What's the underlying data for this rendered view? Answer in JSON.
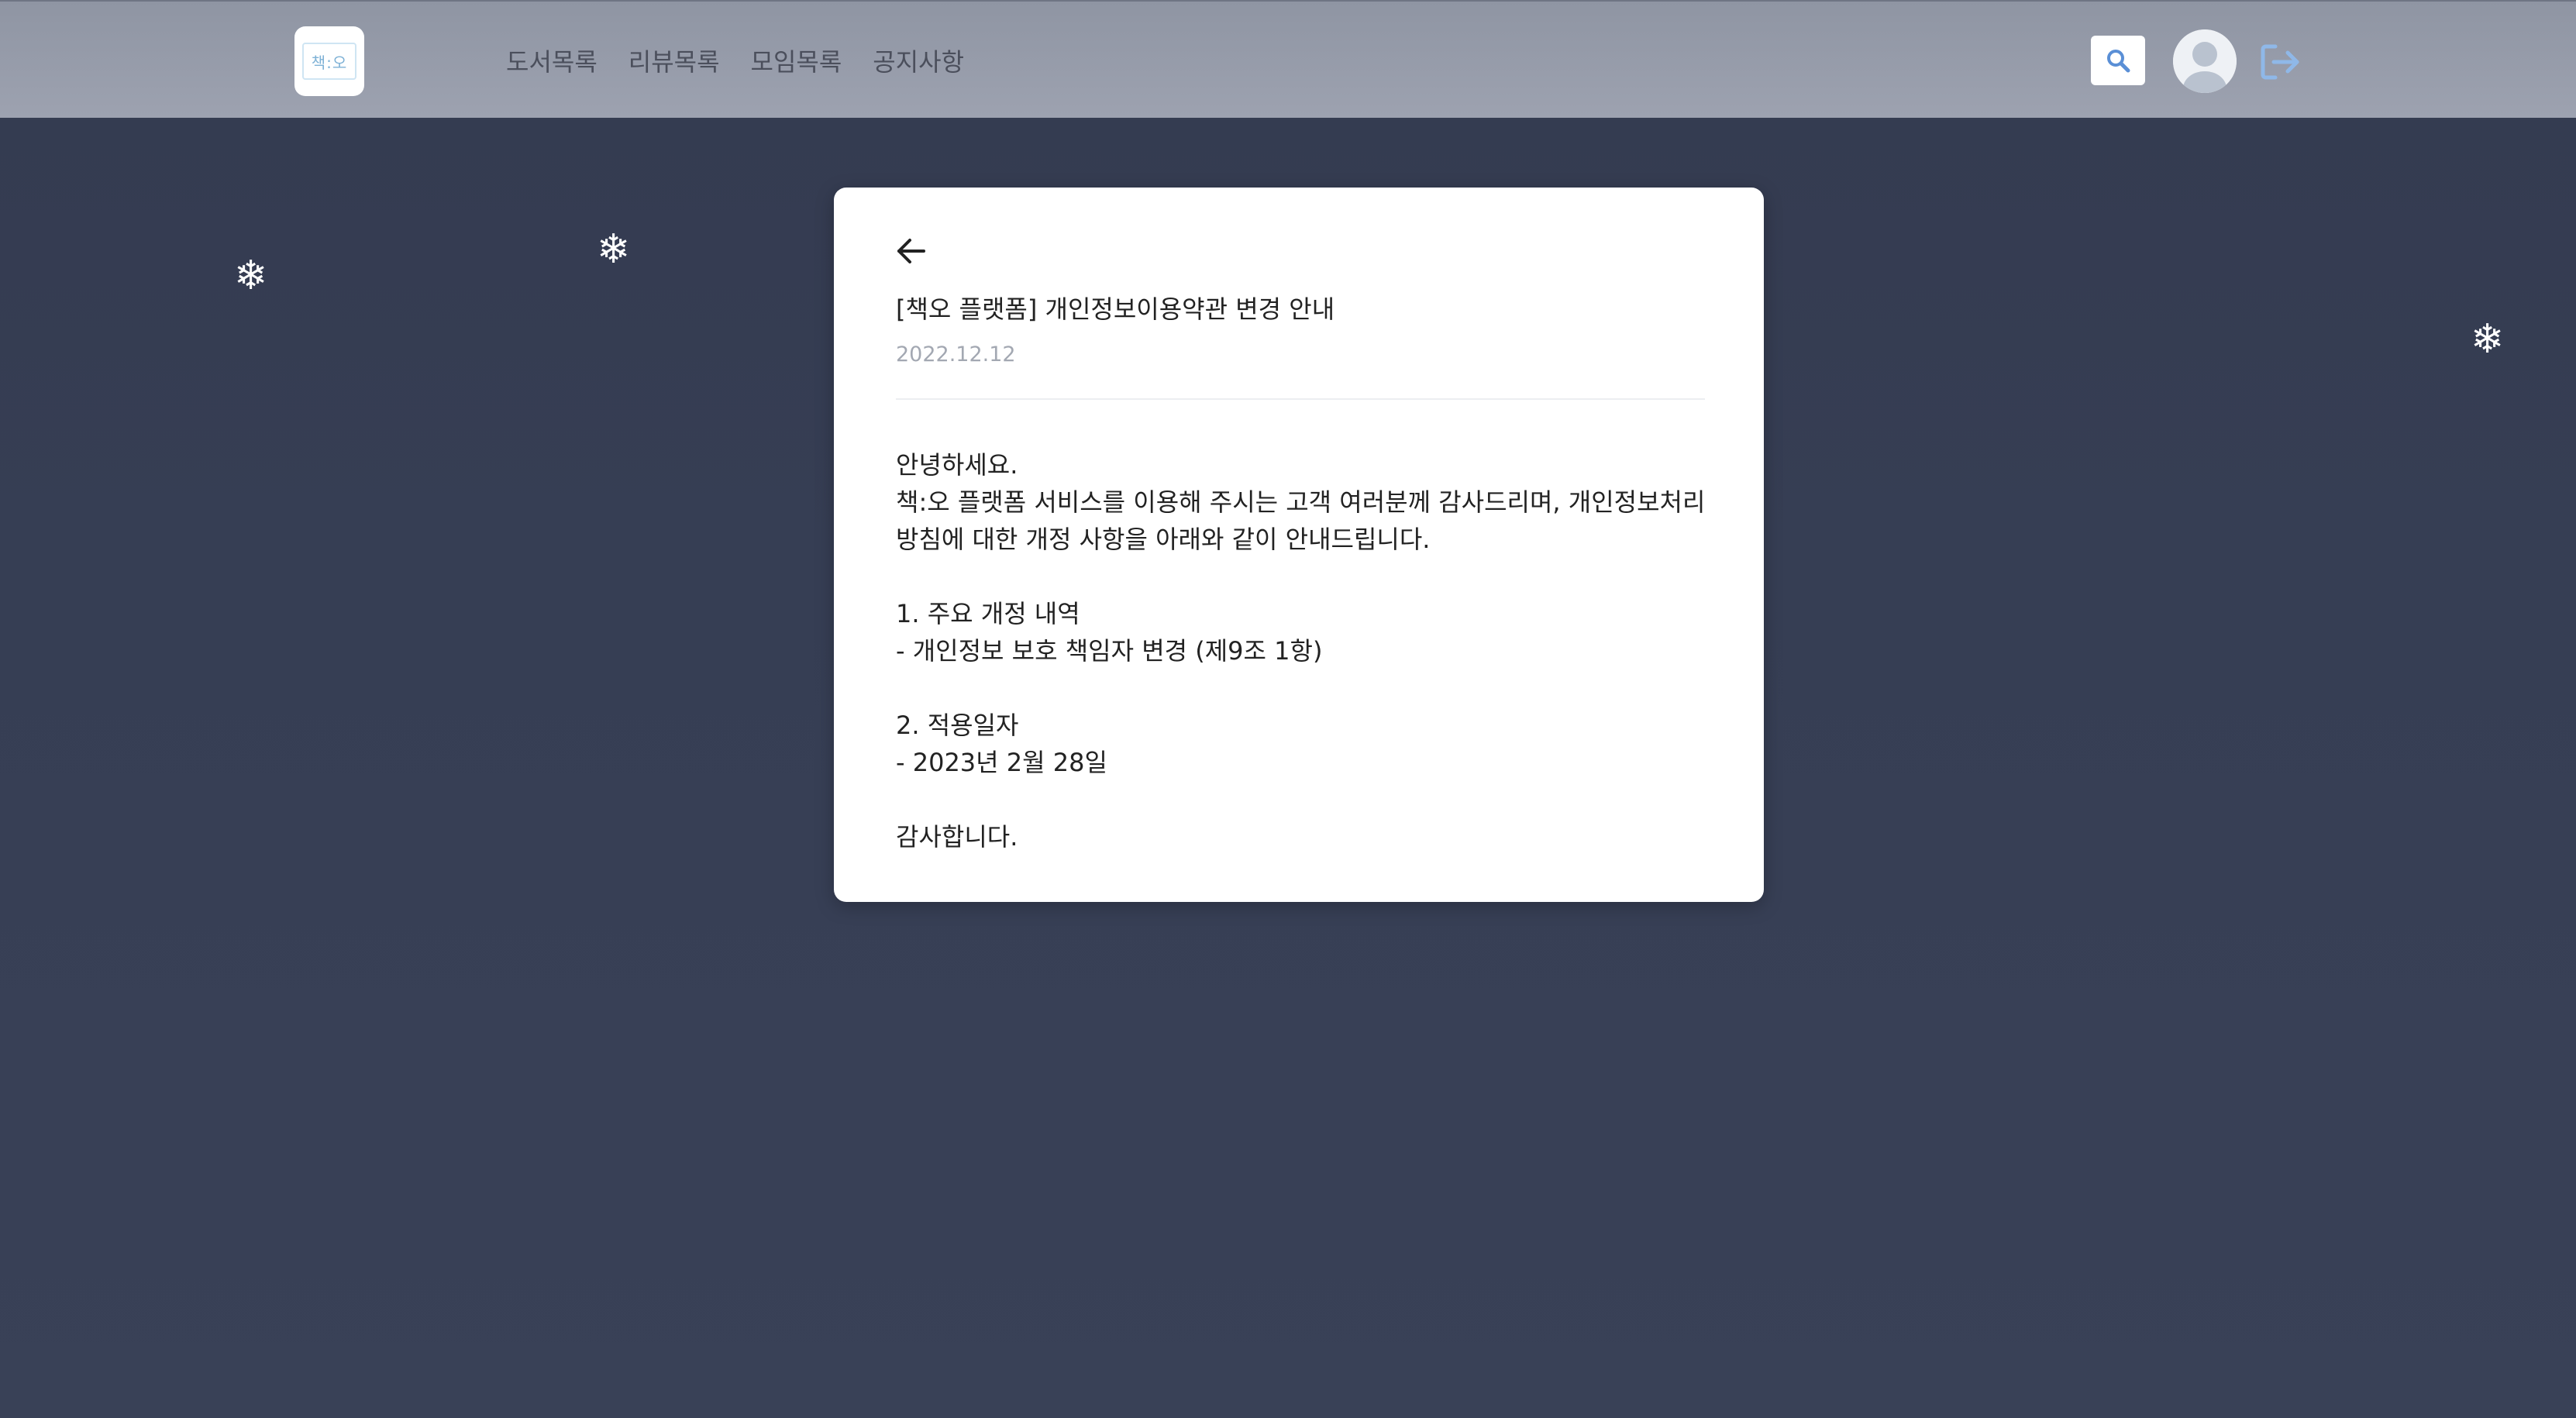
{
  "header": {
    "logo_text": "책:오",
    "nav": [
      {
        "label": "도서목록"
      },
      {
        "label": "리뷰목록"
      },
      {
        "label": "모임목록"
      },
      {
        "label": "공지사항"
      }
    ],
    "icons": [
      "search-icon",
      "avatar-icon",
      "logout-icon"
    ],
    "colors": {
      "topbar": "#9aa0ad",
      "logout_icon": "#8fb8e8"
    }
  },
  "background": {
    "color": "#353d52",
    "decorations": [
      "snowflake",
      "snowflake",
      "snowflake"
    ],
    "snowflake_glyph": "❄"
  },
  "notice": {
    "title": "[책오 플랫폼] 개인정보이용약관 변경 안내",
    "date": "2022.12.12",
    "body": [
      "안녕하세요.",
      "책:오 플랫폼 서비스를 이용해 주시는 고객 여러분께 감사드리며, 개인정보처리",
      "방침에 대한 개정 사항을 아래와 같이 안내드립니다.",
      "",
      "1. 주요 개정 내역",
      "- 개인정보 보호 책임자 변경 (제9조 1항)",
      "",
      "2. 적용일자",
      "- 2023년 2월 28일",
      "",
      "감사합니다."
    ]
  }
}
